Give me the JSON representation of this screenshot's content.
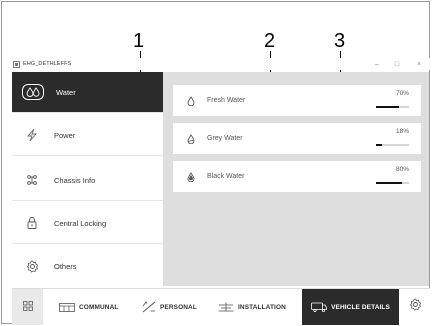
{
  "callouts": [
    "1",
    "2",
    "3"
  ],
  "window": {
    "title": "EHG_DETHLEFFS",
    "controls": {
      "minimize": "–",
      "maximize": "□",
      "close": "×"
    }
  },
  "sidebar": {
    "items": [
      {
        "label": "Water",
        "icon": "water-drops-icon",
        "active": true
      },
      {
        "label": "Power",
        "icon": "lightning-icon"
      },
      {
        "label": "Chassis Info",
        "icon": "chassis-icon"
      },
      {
        "label": "Central Locking",
        "icon": "lock-icon"
      },
      {
        "label": "Others",
        "icon": "gear-icon"
      }
    ]
  },
  "tanks": [
    {
      "label": "Fresh Water",
      "level_text": "70%",
      "level": 0.7,
      "icon": "water-drop-outline-icon"
    },
    {
      "label": "Grey Water",
      "level_text": "18%",
      "level": 0.18,
      "icon": "water-drop-half-icon"
    },
    {
      "label": "Black Water",
      "level_text": "80%",
      "level": 0.8,
      "icon": "water-drop-filled-icon"
    }
  ],
  "bottom_nav": {
    "home_icon": "grid-icon",
    "tabs": [
      {
        "label": "COMMUNAL",
        "icon": "communal-icon"
      },
      {
        "label": "PERSONAL",
        "icon": "personal-icon"
      },
      {
        "label": "INSTALLATION",
        "icon": "installation-icon"
      },
      {
        "label": "VEHICLE DETAILS",
        "icon": "vehicle-icon",
        "active": true
      }
    ],
    "settings_icon": "gear-icon"
  },
  "colors": {
    "active_dark": "#2b2b2b",
    "panel_bg": "#dedede",
    "bar_fill": "#111111"
  }
}
